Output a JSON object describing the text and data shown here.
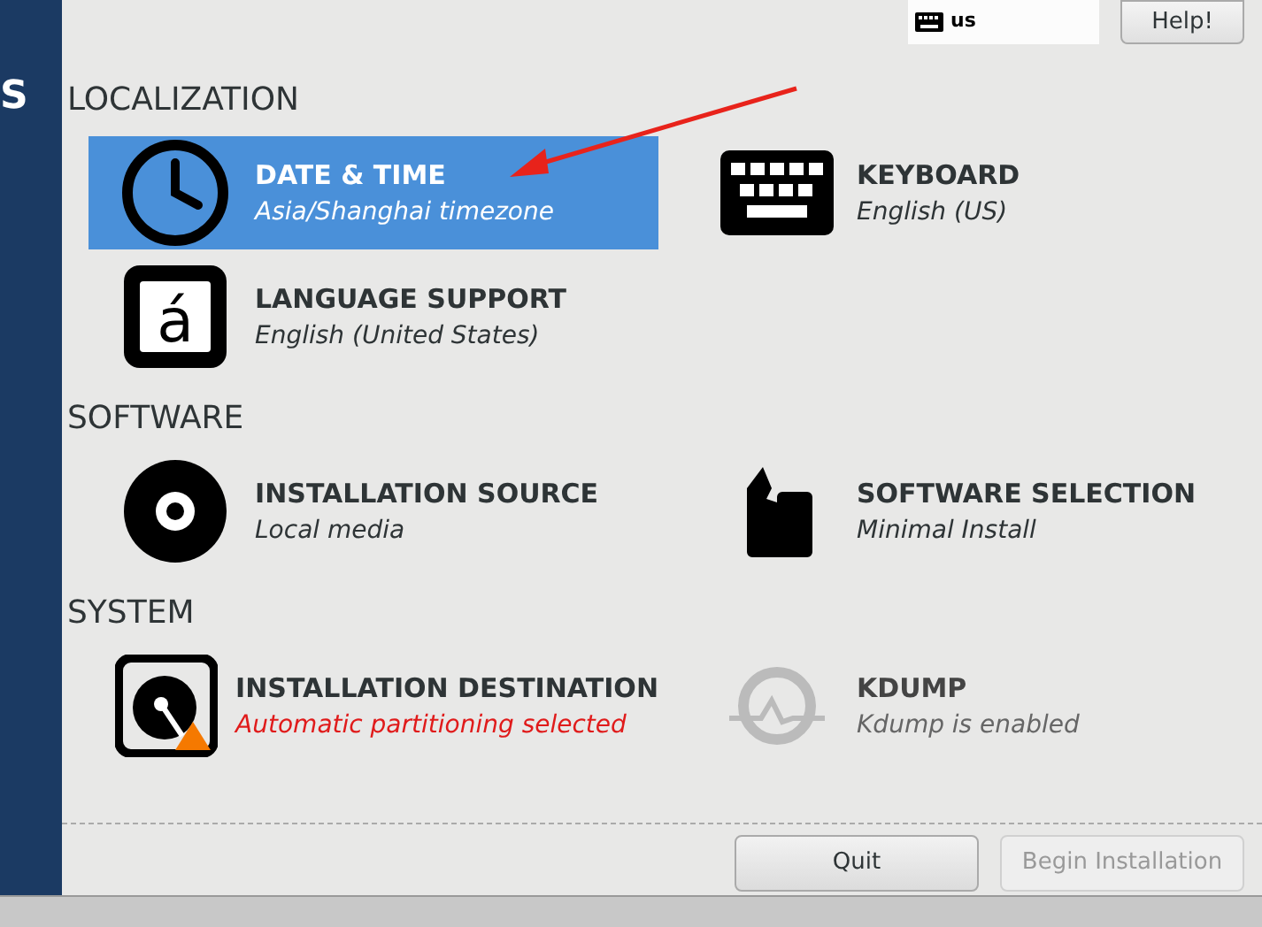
{
  "sidebar": {
    "logo_text": "S"
  },
  "top_bar": {
    "keyboard_layout": "us",
    "help_button": "Help!"
  },
  "sections": [
    {
      "title": "LOCALIZATION",
      "items": [
        {
          "kind": "clock",
          "title": "DATE & TIME",
          "status": "Asia/Shanghai timezone",
          "selected": true,
          "warning": false,
          "disabled": false
        },
        {
          "kind": "keyboard",
          "title": "KEYBOARD",
          "status": "English (US)",
          "selected": false,
          "warning": false,
          "disabled": false
        },
        {
          "kind": "language",
          "glyph": "á",
          "title": "LANGUAGE SUPPORT",
          "status": "English (United States)",
          "selected": false,
          "warning": false,
          "disabled": false
        }
      ]
    },
    {
      "title": "SOFTWARE",
      "items": [
        {
          "kind": "disc",
          "title": "INSTALLATION SOURCE",
          "status": "Local media",
          "selected": false,
          "warning": false,
          "disabled": false
        },
        {
          "kind": "package",
          "title": "SOFTWARE SELECTION",
          "status": "Minimal Install",
          "selected": false,
          "warning": false,
          "disabled": false
        }
      ]
    },
    {
      "title": "SYSTEM",
      "items": [
        {
          "kind": "disk",
          "title": "INSTALLATION DESTINATION",
          "status": "Automatic partitioning selected",
          "selected": false,
          "warning": true,
          "disabled": false
        },
        {
          "kind": "kdump",
          "title": "KDUMP",
          "status": "Kdump is enabled",
          "selected": false,
          "warning": false,
          "disabled": true
        }
      ]
    }
  ],
  "footer": {
    "buttons": [
      {
        "label": "Quit",
        "disabled": false
      },
      {
        "label": "Begin Installation",
        "disabled": true
      }
    ]
  }
}
